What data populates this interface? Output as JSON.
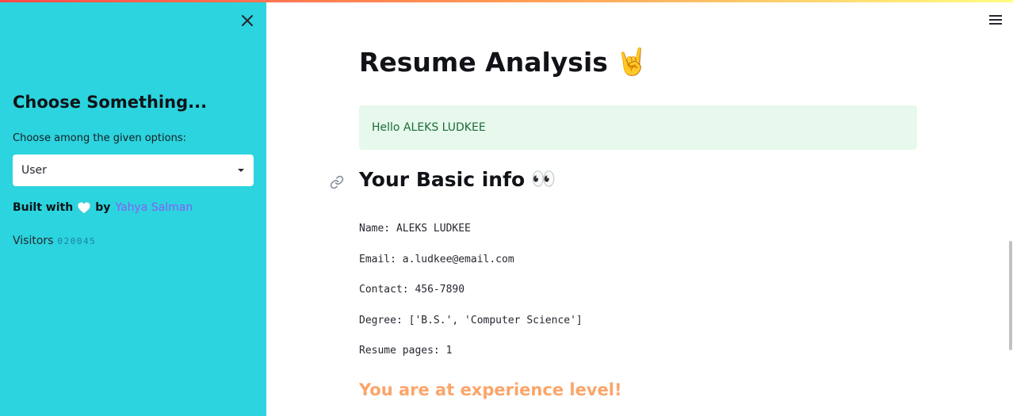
{
  "sidebar": {
    "close_icon": "close-icon",
    "heading": "Choose Something...",
    "select_label": "Choose among the given options:",
    "select_value": "User",
    "built_with_prefix": "Built with",
    "heart_icon": "white-heart",
    "built_with_by": "by",
    "author_name": "Yahya Salman",
    "visitors_label": "Visitors",
    "visitor_count": "020045"
  },
  "header": {
    "menu_icon": "hamburger-icon"
  },
  "main": {
    "title": "Resume Analysis",
    "title_emoji": "🤘",
    "greeting": "Hello ALEKS LUDKEE",
    "basic_info_heading": "Your Basic info",
    "basic_info_emoji": "👀",
    "info_lines": {
      "name": "Name: ALEKS LUDKEE",
      "email": "Email: a.ludkee@email.com",
      "contact": "Contact: 456-7890",
      "degree": "Degree: ['B.S.', 'Computer Science']",
      "pages": "Resume pages: 1"
    },
    "experience_level": "You are at experience level!"
  },
  "colors": {
    "sidebar_bg": "#2bd4de",
    "success_bg": "#e6f9ec",
    "success_text": "#1d6b38",
    "experience_text": "#fba56a",
    "author_link": "#8b5cf6"
  }
}
